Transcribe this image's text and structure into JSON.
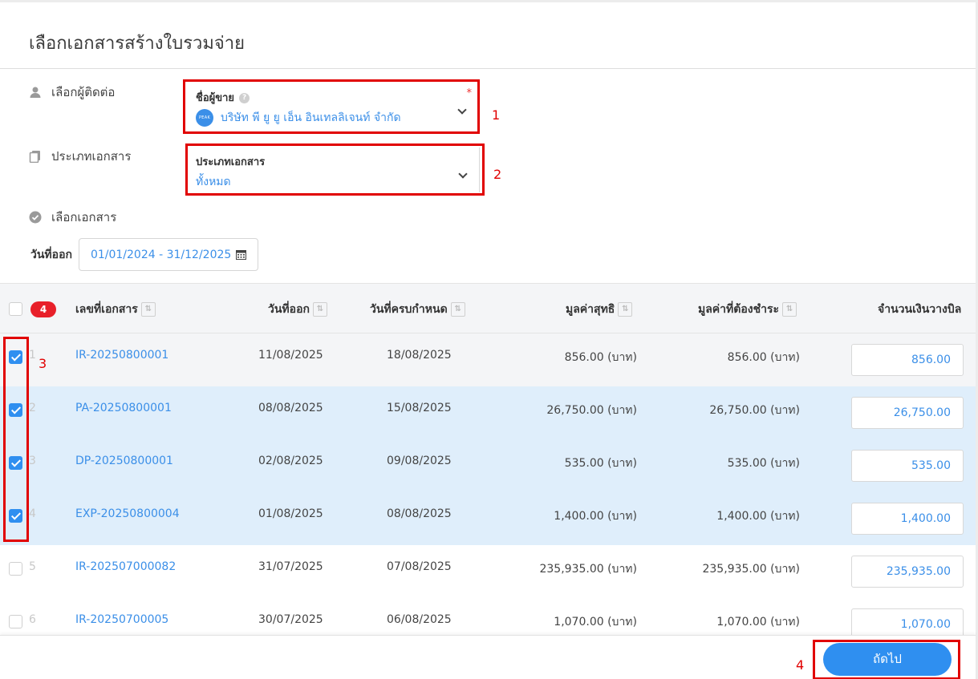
{
  "title": "เลือกเอกสารสร้างใบรวมจ่าย",
  "sections": {
    "contact_label": "เลือกผู้ติดต่อ",
    "doctype_label": "ประเภทเอกสาร",
    "select_docs_label": "เลือกเอกสาร"
  },
  "vendor_field": {
    "label": "ชื่อผู้ขาย",
    "help": "?",
    "required": "*",
    "logo_text": "PEAK",
    "value": "บริษัท พี ยู ยู เอ็น อินเทลลิเจนท์ จำกัด"
  },
  "doctype_field": {
    "label": "ประเภทเอกสาร",
    "value": "ทั้งหมด"
  },
  "date_filter": {
    "label": "วันที่ออก",
    "value": "01/01/2024 - 31/12/2025"
  },
  "annotations": [
    "1",
    "2",
    "3",
    "4"
  ],
  "table": {
    "selected_count": "4",
    "columns": {
      "doc_no": "เลขที่เอกสาร",
      "issue_date": "วันที่ออก",
      "due_date": "วันที่ครบกำหนด",
      "net_value": "มูลค่าสุทธิ",
      "payable": "มูลค่าที่ต้องชำระ",
      "billing_amount": "จำนวนเงินวางบิล"
    },
    "rows": [
      {
        "num": "1",
        "doc_no": "IR-20250800001",
        "issue_date": "11/08/2025",
        "due_date": "18/08/2025",
        "net_value": "856.00 (บาท)",
        "payable": "856.00 (บาท)",
        "billing_amount": "856.00",
        "checked": true
      },
      {
        "num": "2",
        "doc_no": "PA-20250800001",
        "issue_date": "08/08/2025",
        "due_date": "15/08/2025",
        "net_value": "26,750.00 (บาท)",
        "payable": "26,750.00 (บาท)",
        "billing_amount": "26,750.00",
        "checked": true
      },
      {
        "num": "3",
        "doc_no": "DP-20250800001",
        "issue_date": "02/08/2025",
        "due_date": "09/08/2025",
        "net_value": "535.00 (บาท)",
        "payable": "535.00 (บาท)",
        "billing_amount": "535.00",
        "checked": true
      },
      {
        "num": "4",
        "doc_no": "EXP-20250800004",
        "issue_date": "01/08/2025",
        "due_date": "08/08/2025",
        "net_value": "1,400.00 (บาท)",
        "payable": "1,400.00 (บาท)",
        "billing_amount": "1,400.00",
        "checked": true
      },
      {
        "num": "5",
        "doc_no": "IR-202507000082",
        "issue_date": "31/07/2025",
        "due_date": "07/08/2025",
        "net_value": "235,935.00 (บาท)",
        "payable": "235,935.00 (บาท)",
        "billing_amount": "235,935.00",
        "checked": false
      },
      {
        "num": "6",
        "doc_no": "IR-20250700005",
        "issue_date": "30/07/2025",
        "due_date": "06/08/2025",
        "net_value": "1,070.00 (บาท)",
        "payable": "1,070.00 (บาท)",
        "billing_amount": "1,070.00",
        "checked": false
      }
    ]
  },
  "footer": {
    "next_label": "ถัดไป"
  },
  "colors": {
    "accent": "#2f8ff0",
    "link": "#3b8fe8",
    "annotation_red": "#e10000",
    "selected_row": "#dfeefb"
  }
}
